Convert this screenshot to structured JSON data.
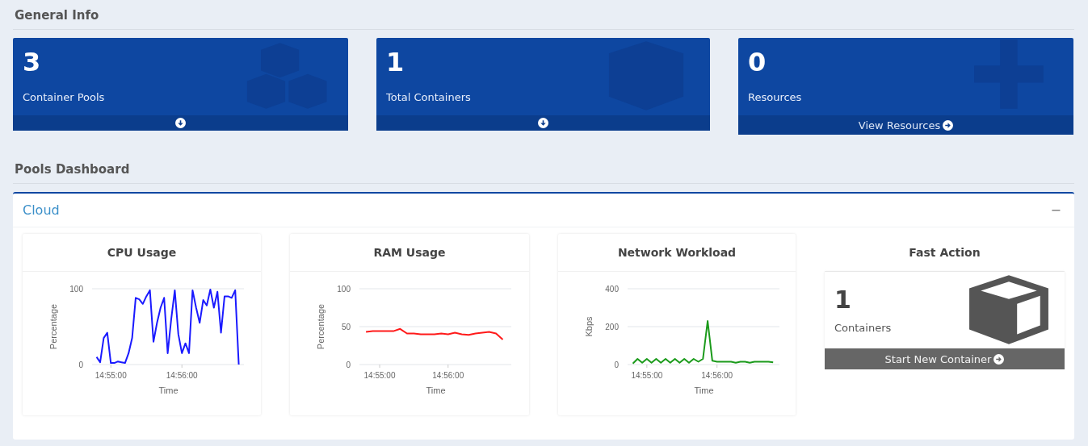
{
  "general_info": {
    "title": "General Info",
    "cards": [
      {
        "value": "3",
        "label": "Container Pools"
      },
      {
        "value": "1",
        "label": "Total Containers"
      },
      {
        "value": "0",
        "label": "Resources",
        "footer_label": "View Resources"
      }
    ]
  },
  "pools_dashboard": {
    "title": "Pools Dashboard",
    "panel": {
      "title": "Cloud",
      "toggle": "−",
      "charts": [
        {
          "title": "CPU Usage",
          "chart_data": {
            "type": "line",
            "xlabel": "Time",
            "ylabel": "Percentage",
            "ylim": [
              0,
              100
            ],
            "yticks": [
              0,
              100
            ],
            "categories": [
              null,
              null,
              null,
              null,
              "14:55:00",
              null,
              null,
              null,
              null,
              null,
              null,
              null,
              null,
              null,
              null,
              null,
              null,
              null,
              null,
              null,
              null,
              null,
              null,
              null,
              "14:56:00",
              null,
              null,
              null,
              null,
              null,
              null,
              null,
              null,
              null,
              null,
              null,
              null,
              null,
              null,
              null,
              null
            ],
            "series": [
              {
                "color": "#1a1aff",
                "values": [
                  10,
                  3,
                  35,
                  42,
                  2,
                  2,
                  4,
                  3,
                  2,
                  15,
                  35,
                  88,
                  86,
                  80,
                  90,
                  98,
                  30,
                  55,
                  75,
                  88,
                  15,
                  60,
                  98,
                  40,
                  15,
                  28,
                  15,
                  98,
                  75,
                  55,
                  85,
                  78,
                  99,
                  75,
                  96,
                  42,
                  90,
                  90,
                  88,
                  98,
                  0
                ]
              }
            ]
          }
        },
        {
          "title": "RAM Usage",
          "chart_data": {
            "type": "line",
            "xlabel": "Time",
            "ylabel": "Percentage",
            "ylim": [
              0,
              100
            ],
            "yticks": [
              0,
              50,
              100
            ],
            "categories": [
              null,
              null,
              "14:55:00",
              null,
              null,
              null,
              null,
              null,
              null,
              null,
              null,
              null,
              "14:56:00",
              null,
              null,
              null,
              null,
              null,
              null,
              null,
              null
            ],
            "series": [
              {
                "color": "#ff1a1a",
                "values": [
                  43,
                  44,
                  44,
                  44,
                  44,
                  47,
                  41,
                  41,
                  40,
                  40,
                  40,
                  41,
                  40,
                  42,
                  40,
                  39,
                  41,
                  42,
                  43,
                  41,
                  33
                ]
              }
            ]
          }
        },
        {
          "title": "Network Workload",
          "chart_data": {
            "type": "line",
            "xlabel": "Time",
            "ylabel": "Kbps",
            "ylim": [
              0,
              400
            ],
            "yticks": [
              0,
              200,
              400
            ],
            "categories": [
              null,
              null,
              null,
              "14:55:00",
              null,
              null,
              null,
              null,
              null,
              null,
              null,
              null,
              null,
              null,
              null,
              null,
              null,
              null,
              "14:56:00",
              null,
              null,
              null,
              null,
              null,
              null,
              null,
              null,
              null,
              null,
              null,
              null
            ],
            "series": [
              {
                "color": "#1a9a1a",
                "values": [
                  5,
                  30,
                  10,
                  30,
                  10,
                  30,
                  10,
                  30,
                  10,
                  30,
                  10,
                  30,
                  10,
                  30,
                  15,
                  30,
                  230,
                  20,
                  15,
                  15,
                  15,
                  15,
                  10,
                  15,
                  15,
                  10,
                  15,
                  15,
                  15,
                  15,
                  12
                ]
              }
            ]
          }
        }
      ],
      "fast_action": {
        "title": "Fast Action",
        "value": "1",
        "label": "Containers",
        "button": "Start New Container"
      }
    }
  }
}
